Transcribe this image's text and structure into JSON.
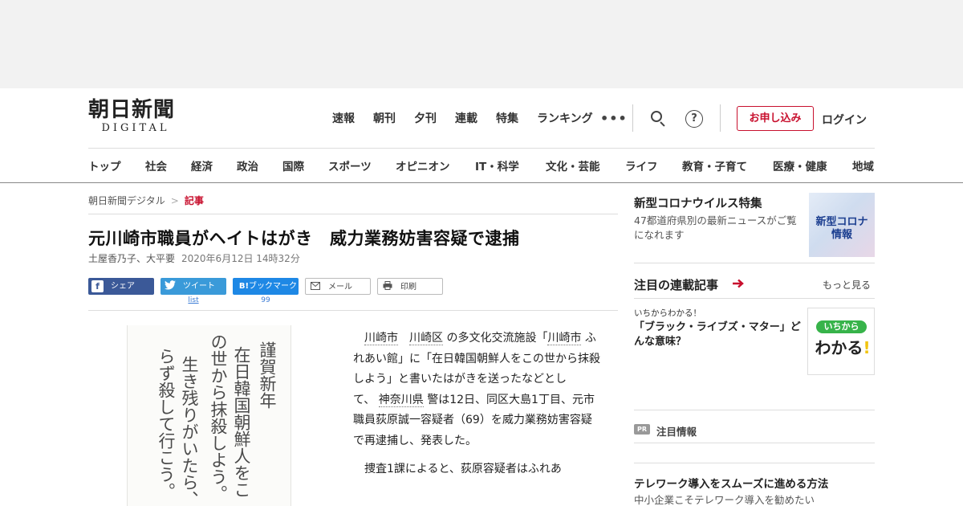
{
  "header": {
    "logo_jp": "朝日新聞",
    "logo_en": "DIGITAL",
    "top_nav": [
      "速報",
      "朝刊",
      "夕刊",
      "連載",
      "特集",
      "ランキング"
    ],
    "more": "•••",
    "help": "?",
    "subscribe": "お申し込み",
    "login": "ログイン"
  },
  "section_nav": [
    "トップ",
    "社会",
    "経済",
    "政治",
    "国際",
    "スポーツ",
    "オピニオン",
    "IT・科学",
    "文化・芸能",
    "ライフ",
    "教育・子育て",
    "医療・健康",
    "地域"
  ],
  "breadcrumb": {
    "home": "朝日新聞デジタル",
    "separator": ">",
    "current": "記事"
  },
  "article": {
    "headline": "元川崎市職員がヘイトはがき　威力業務妨害容疑で逮捕",
    "authors": "土屋香乃子、大平要",
    "date": "2020年6月12日 14時32分",
    "share": {
      "facebook": "シェア",
      "twitter": "ツイート",
      "twitter_count": "list",
      "hatena_icon": "B!",
      "hatena": "ブックマーク",
      "hatena_count": "99",
      "mail": "メール",
      "print": "印刷"
    },
    "photo_columns": [
      "謹賀新年",
      "在日韓国朝鮮人をこ",
      "の世から抹殺しよう。",
      "生き残りがいたら、残",
      "らず殺して行こう。"
    ],
    "body": {
      "p1_kw1": "川崎市",
      "p1_kw2": "川崎区",
      "p1_t1": "の多文化交流施設「",
      "p1_kw3": "川崎市",
      "p1_t2": "ふれあい館」に「在日韓国朝鮮人をこの世から抹殺しよう」と書いたはがきを送ったなどとして、",
      "p1_kw4": "神奈川県",
      "p1_t3": "警は12日、同区大島1丁目、元市職員荻原誠一容疑者（69）を威力業務妨害容疑で再逮捕し、発表した。",
      "p2": "捜査1課によると、荻原容疑者はふれあ"
    }
  },
  "sidebar": {
    "corona": {
      "title": "新型コロナウイルス特集",
      "desc": "47都道府県別の最新ニュースがご覧になれます",
      "thumb_line1": "新型コロナ",
      "thumb_line2": "情報"
    },
    "serial": {
      "title": "注目の連載記事",
      "more": "もっと見る",
      "kicker": "いちからわかる！",
      "headline": "「ブラック・ライブズ・マター」どんな意味？",
      "thumb_pill": "いちから",
      "thumb_big": "わかる",
      "thumb_mark": "!"
    },
    "pr": {
      "badge": "PR",
      "label": "注目情報",
      "title": "テレワーク導入をスムーズに進める方法",
      "desc": "中小企業こそテレワーク導入を勧めたい"
    }
  },
  "colors": {
    "brand_red": "#c8102e",
    "facebook": "#3b5998",
    "twitter": "#3a9ad9",
    "hatena": "#1e88e5",
    "ichikara_green": "#37b34a"
  }
}
